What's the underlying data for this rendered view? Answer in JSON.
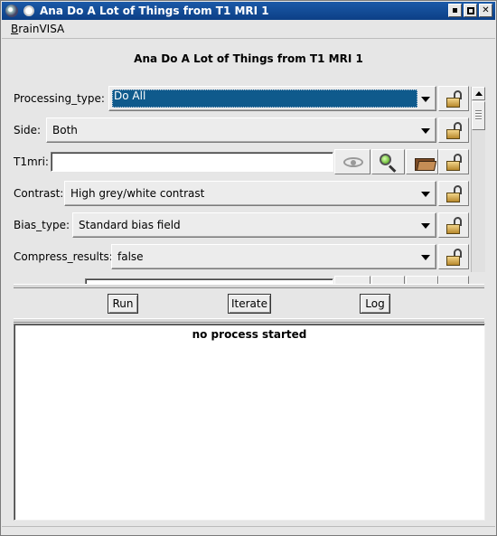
{
  "window": {
    "title": "Ana Do A Lot of Things from T1 MRI 1",
    "controls": [
      "minimize-icon",
      "maximize-icon",
      "close-icon"
    ]
  },
  "menubar": {
    "items": [
      {
        "label_underlined": "B",
        "label_rest": "rainVISA"
      }
    ]
  },
  "process": {
    "heading": "Ana Do A Lot of Things from T1 MRI 1"
  },
  "form": {
    "processing_type": {
      "label": "Processing_type:",
      "value": "Do All"
    },
    "side": {
      "label": "Side:",
      "value": "Both"
    },
    "t1mri": {
      "label": "T1mri:",
      "value": ""
    },
    "contrast": {
      "label": "Contrast:",
      "value": "High grey/white contrast"
    },
    "bias_type": {
      "label": "Bias_type:",
      "value": "Standard bias field"
    },
    "compress_results": {
      "label": "Compress_results:",
      "value": "false"
    }
  },
  "icons": {
    "lock": "unlocked-padlock-icon",
    "view": "eye-icon",
    "database_search": "magnifier-icon",
    "browse": "folder-icon"
  },
  "actions": {
    "run": "Run",
    "iterate": "Iterate",
    "log": "Log"
  },
  "output": {
    "status": "no process started"
  }
}
